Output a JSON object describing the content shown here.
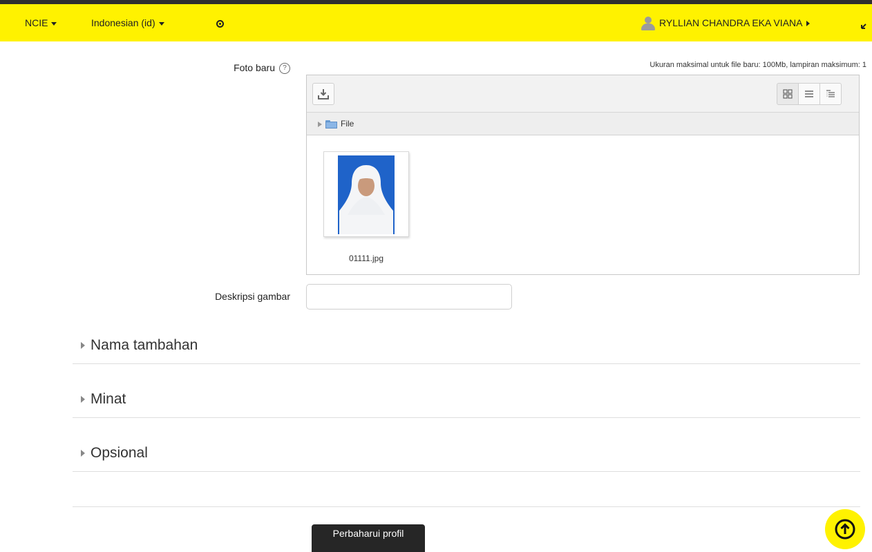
{
  "colors": {
    "navbar": "#fff200",
    "submit_bg": "#262626",
    "photo_bg": "#1f63c9"
  },
  "navbar": {
    "site_menu": "NCIE",
    "language_menu": "Indonesian (id)",
    "user_name": "RYLLIAN CHANDRA EKA VIANA",
    "icons": [
      "chevron-down-icon",
      "circle-down-icon",
      "user-icon",
      "caret-right-icon",
      "expand-icon"
    ]
  },
  "form": {
    "new_photo_label": "Foto baru",
    "max_size_note": "Ukuran maksimal untuk file baru: 100Mb, lampiran maksimum: 1",
    "filepicker": {
      "path_folder": "File",
      "files": [
        {
          "name": "01111.jpg"
        }
      ],
      "view_icons": [
        "grid-view-icon",
        "list-view-icon",
        "tree-view-icon"
      ]
    },
    "image_description_label": "Deskripsi gambar",
    "image_description_value": ""
  },
  "sections": [
    {
      "title": "Nama tambahan"
    },
    {
      "title": "Minat"
    },
    {
      "title": "Opsional"
    }
  ],
  "submit_label": "Perbaharui profil"
}
